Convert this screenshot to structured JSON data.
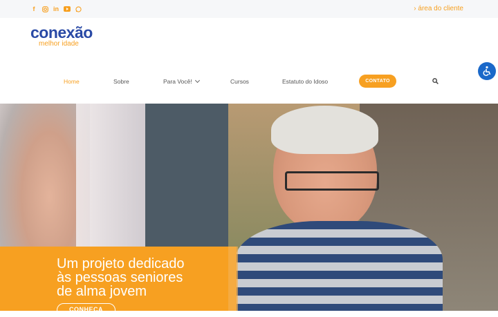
{
  "topbar": {
    "social_icons": [
      "facebook-icon",
      "instagram-icon",
      "linkedin-icon",
      "youtube-icon",
      "whatsapp-icon"
    ],
    "client_area": "› área do cliente"
  },
  "logo": {
    "name": "conexão",
    "tagline": "melhor idade"
  },
  "nav": {
    "items": [
      "Home",
      "Sobre",
      "Para Você!",
      "Cursos",
      "Estatuto do Idoso"
    ],
    "contact": "CONTATO"
  },
  "hero": {
    "headline_lines": [
      "Um projeto dedicado",
      "às pessoas seniores",
      "de alma jovem"
    ],
    "cta": "CONHEÇA"
  },
  "colors": {
    "accent": "#f7a021",
    "brand": "#2a4aa6",
    "accessibility": "#1a68c9"
  }
}
